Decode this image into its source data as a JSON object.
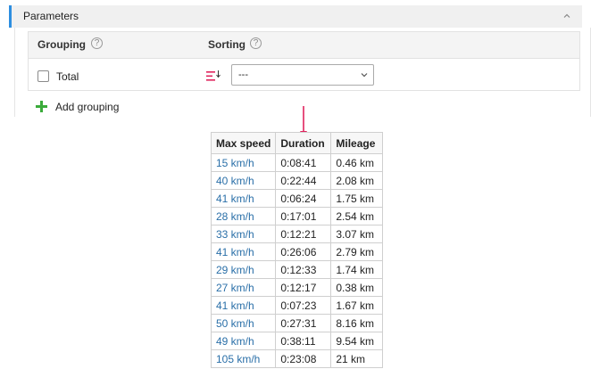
{
  "parameters": {
    "title": "Parameters",
    "grouping_label": "Grouping",
    "sorting_label": "Sorting",
    "help_glyph": "?",
    "total_label": "Total",
    "total_checked": false,
    "sort_value": "---",
    "add_grouping_label": "Add grouping"
  },
  "results": {
    "headers": [
      "Max speed",
      "Duration",
      "Mileage"
    ],
    "rows": [
      [
        "15 km/h",
        "0:08:41",
        "0.46 km"
      ],
      [
        "40 km/h",
        "0:22:44",
        "2.08 km"
      ],
      [
        "41 km/h",
        "0:06:24",
        "1.75 km"
      ],
      [
        "28 km/h",
        "0:17:01",
        "2.54 km"
      ],
      [
        "33 km/h",
        "0:12:21",
        "3.07 km"
      ],
      [
        "41 km/h",
        "0:26:06",
        "2.79 km"
      ],
      [
        "29 km/h",
        "0:12:33",
        "1.74 km"
      ],
      [
        "27 km/h",
        "0:12:17",
        "0.38 km"
      ],
      [
        "41 km/h",
        "0:07:23",
        "1.67 km"
      ],
      [
        "50 km/h",
        "0:27:31",
        "8.16 km"
      ],
      [
        "49 km/h",
        "0:38:11",
        "9.54 km"
      ],
      [
        "105 km/h",
        "0:23:08",
        "21 km"
      ]
    ]
  },
  "colors": {
    "accent": "#2d8ee0",
    "link": "#2a6fa8",
    "add_icon": "#3bab3b",
    "sort_icon": "#e0245e",
    "arrow": "#e0245e"
  },
  "icons": {
    "collapse": "chevron-up-icon",
    "help": "help-icon",
    "sort": "sort-descending-icon",
    "dropdown": "chevron-down-icon",
    "add": "plus-icon"
  }
}
